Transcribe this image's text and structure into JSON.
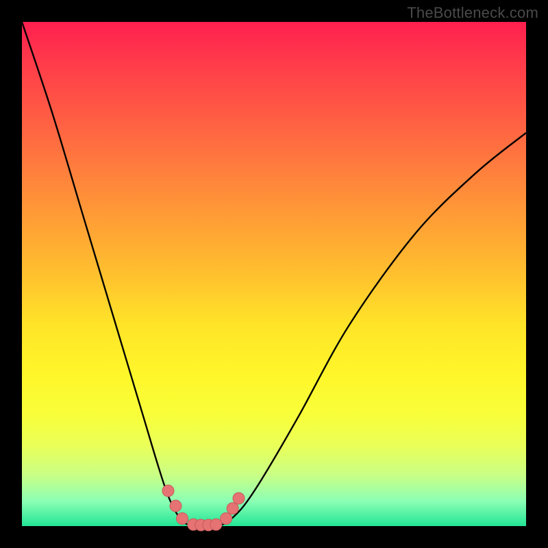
{
  "watermark": "TheBottleneck.com",
  "chart_data": {
    "type": "line",
    "title": "",
    "xlabel": "",
    "ylabel": "",
    "xlim": [
      0,
      100
    ],
    "ylim": [
      0,
      100
    ],
    "series": [
      {
        "name": "left-curve",
        "x": [
          0,
          6,
          12,
          18,
          24,
          27,
          29,
          31,
          32.5,
          34
        ],
        "y": [
          100,
          82,
          62,
          42,
          22,
          12,
          6,
          2,
          0.5,
          0
        ]
      },
      {
        "name": "right-curve",
        "x": [
          39,
          41,
          44,
          48,
          55,
          65,
          78,
          90,
          100
        ],
        "y": [
          0,
          1,
          4,
          10,
          22,
          40,
          58,
          70,
          78
        ]
      },
      {
        "name": "flat-minimum",
        "x": [
          34,
          36,
          38,
          39
        ],
        "y": [
          0,
          0,
          0,
          0
        ]
      }
    ],
    "markers": [
      {
        "x": 29.0,
        "y": 7.0
      },
      {
        "x": 30.5,
        "y": 4.0
      },
      {
        "x": 31.8,
        "y": 1.5
      },
      {
        "x": 34.0,
        "y": 0.3
      },
      {
        "x": 35.5,
        "y": 0.2
      },
      {
        "x": 37.0,
        "y": 0.2
      },
      {
        "x": 38.5,
        "y": 0.3
      },
      {
        "x": 40.5,
        "y": 1.5
      },
      {
        "x": 41.8,
        "y": 3.5
      },
      {
        "x": 43.0,
        "y": 5.5
      }
    ],
    "colors": {
      "curve": "#000000",
      "marker_fill": "#e57373",
      "marker_stroke": "#c75c5c"
    }
  }
}
